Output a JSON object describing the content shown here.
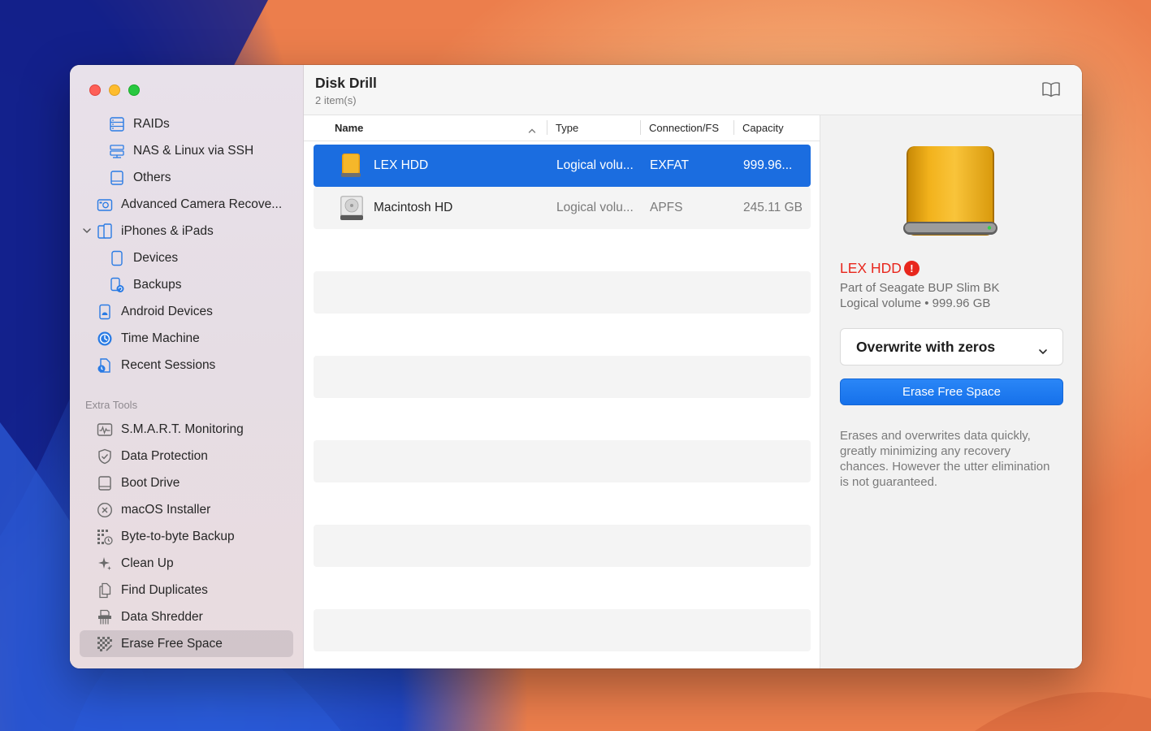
{
  "window": {
    "title": "Disk Drill",
    "subtitle": "2 item(s)"
  },
  "sidebar": {
    "items": [
      {
        "label": "RAIDs",
        "icon": "raid-icon"
      },
      {
        "label": "NAS & Linux via SSH",
        "icon": "nas-icon"
      },
      {
        "label": "Others",
        "icon": "drive-icon"
      },
      {
        "label": "Advanced Camera Recove...",
        "icon": "camera-icon"
      },
      {
        "label": "iPhones & iPads",
        "icon": "iphone-icon"
      },
      {
        "label": "Devices",
        "icon": "device-icon"
      },
      {
        "label": "Backups",
        "icon": "backup-icon"
      },
      {
        "label": "Android Devices",
        "icon": "android-icon"
      },
      {
        "label": "Time Machine",
        "icon": "time-machine-icon"
      },
      {
        "label": "Recent Sessions",
        "icon": "recent-sessions-icon"
      }
    ],
    "extra_tools_heading": "Extra Tools",
    "tools": [
      {
        "label": "S.M.A.R.T. Monitoring",
        "icon": "smart-monitor-icon"
      },
      {
        "label": "Data Protection",
        "icon": "shield-icon"
      },
      {
        "label": "Boot Drive",
        "icon": "boot-drive-icon"
      },
      {
        "label": "macOS Installer",
        "icon": "macos-installer-icon"
      },
      {
        "label": "Byte-to-byte Backup",
        "icon": "byte-backup-icon"
      },
      {
        "label": "Clean Up",
        "icon": "sparkle-icon"
      },
      {
        "label": "Find Duplicates",
        "icon": "duplicates-icon"
      },
      {
        "label": "Data Shredder",
        "icon": "shredder-icon"
      },
      {
        "label": "Erase Free Space",
        "icon": "erase-free-space-icon"
      }
    ]
  },
  "table": {
    "columns": [
      "Name",
      "Type",
      "Connection/FS",
      "Capacity"
    ],
    "rows": [
      {
        "name": "LEX HDD",
        "type": "Logical volu...",
        "fs": "EXFAT",
        "capacity": "999.96..."
      },
      {
        "name": "Macintosh HD",
        "type": "Logical volu...",
        "fs": "APFS",
        "capacity": "245.11 GB"
      }
    ]
  },
  "detail": {
    "name": "LEX HDD",
    "warning_glyph": "!",
    "part_of": "Part of Seagate BUP Slim BK",
    "volume_info": "Logical volume • 999.96 GB",
    "method": "Overwrite with zeros",
    "button": "Erase Free Space",
    "description": "Erases and overwrites data quickly, greatly minimizing any recovery chances. However the utter elimination is not guaranteed."
  },
  "colors": {
    "accent": "#1b6de0",
    "warning": "#e8261c"
  }
}
